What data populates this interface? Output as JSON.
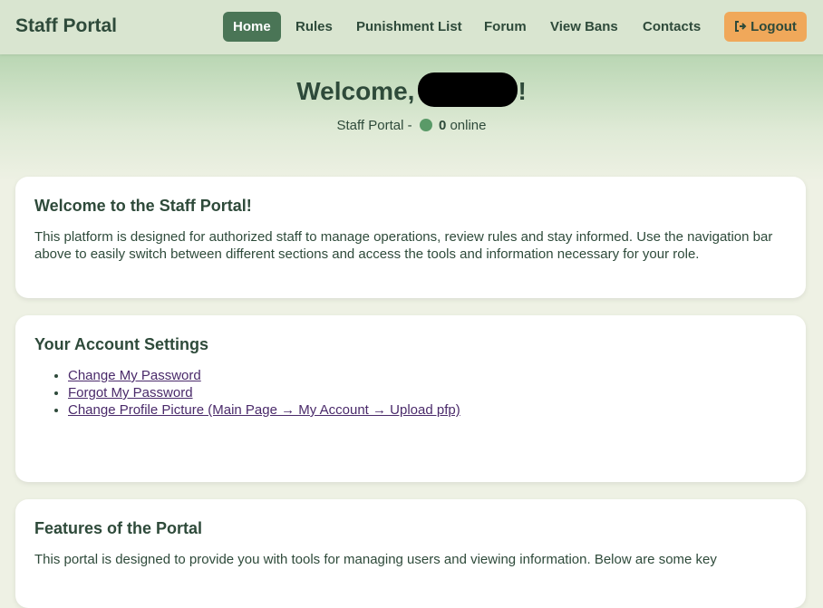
{
  "header": {
    "brand": "Staff Portal",
    "nav": [
      {
        "label": "Home",
        "active": true
      },
      {
        "label": "Rules"
      },
      {
        "label": "Punishment List"
      },
      {
        "label": "Forum"
      },
      {
        "label": "View Bans"
      },
      {
        "label": "Contacts"
      }
    ],
    "logout_label": "Logout",
    "logout_icon": "logout-icon"
  },
  "hero": {
    "welcome_prefix": "Welcome,",
    "welcome_suffix": "!",
    "status_prefix": "Staff Portal -",
    "online_count": "0",
    "online_suffix": "online"
  },
  "intro": {
    "title": "Welcome to the Staff Portal!",
    "body": "This platform is designed for authorized staff to manage operations, review rules and stay informed. Use the navigation bar above to easily switch between different sections and access the tools and information necessary for your role."
  },
  "account": {
    "title": "Your Account Settings",
    "links": [
      "Change My Password",
      "Forgot My Password",
      "Change Profile Picture (Main Page → My Account → Upload pfp)"
    ]
  },
  "features": {
    "title": "Features of the Portal",
    "body": "This portal is designed to provide you with tools for managing users and viewing information. Below are some key"
  },
  "colors": {
    "accent": "#4a7556",
    "logout": "#f0a85a",
    "online": "#5a9a68"
  }
}
